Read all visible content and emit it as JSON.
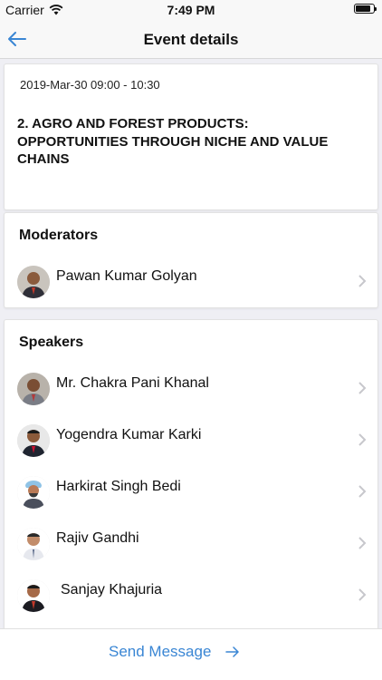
{
  "status_bar": {
    "carrier": "Carrier",
    "time": "7:49 PM"
  },
  "nav": {
    "title": "Event details"
  },
  "event": {
    "datetime": "2019-Mar-30 09:00 - 10:30",
    "title_line1": "2. AGRO AND FOREST PRODUCTS:",
    "title_line2": "OPPORTUNITIES THROUGH NICHE AND VALUE",
    "title_line3": "CHAINS"
  },
  "moderators": {
    "heading": "Moderators",
    "people": [
      {
        "name": "Pawan Kumar Golyan"
      }
    ]
  },
  "speakers": {
    "heading": "Speakers",
    "people": [
      {
        "name": "Mr. Chakra Pani Khanal"
      },
      {
        "name": "Yogendra Kumar Karki"
      },
      {
        "name": "Harkirat Singh Bedi"
      },
      {
        "name": "Rajiv Gandhi"
      },
      {
        "name": "Sanjay Khajuria"
      }
    ]
  },
  "footer": {
    "send_label": "Send Message"
  },
  "colors": {
    "accent": "#3a86d4",
    "background": "#efeff4"
  }
}
